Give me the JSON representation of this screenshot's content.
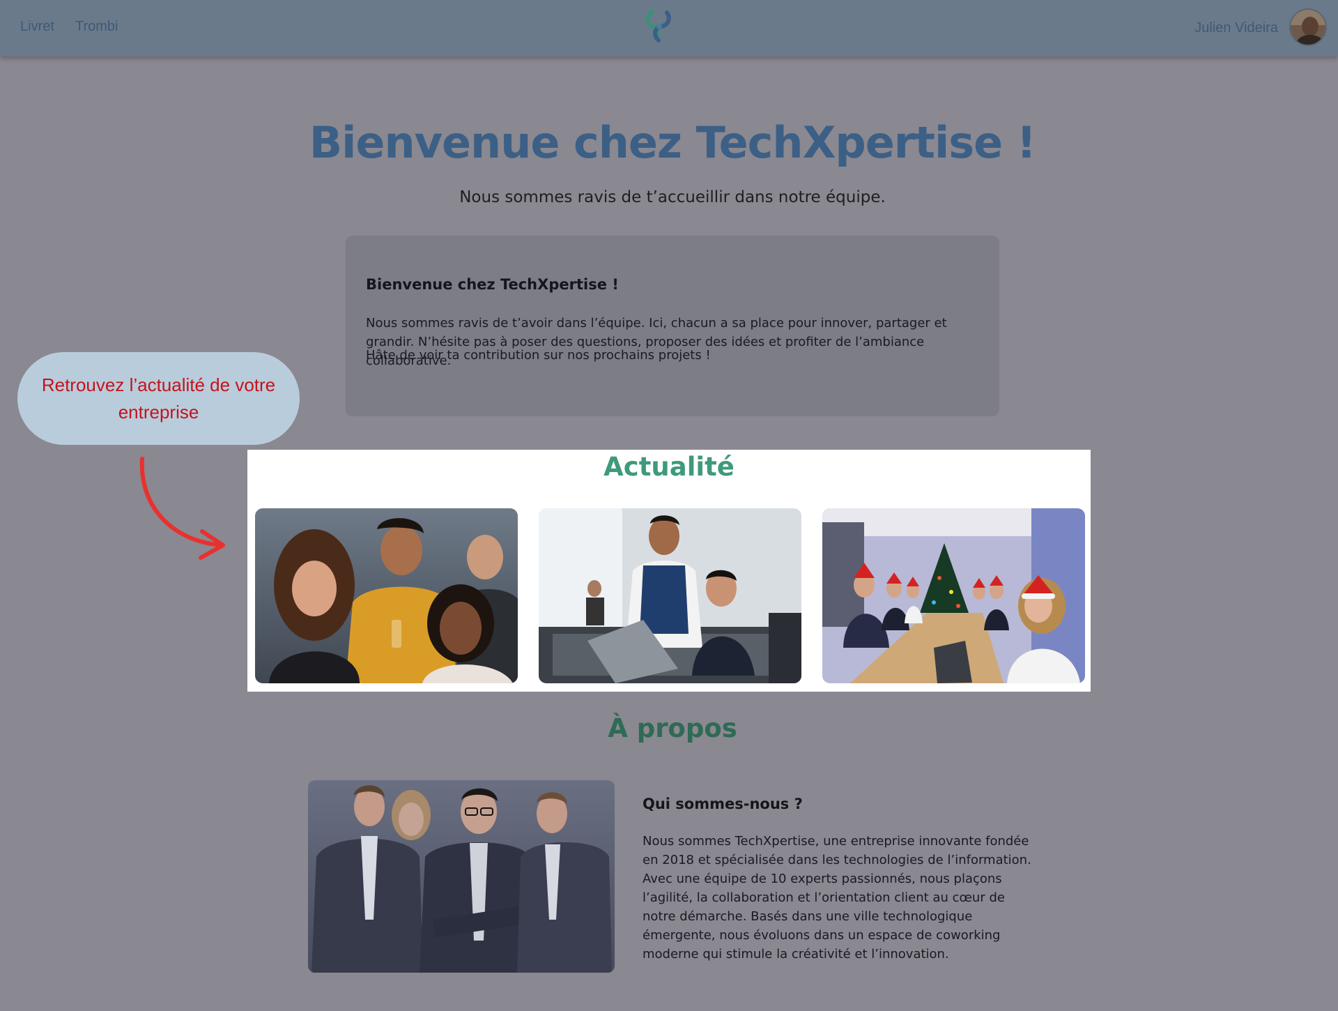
{
  "nav": {
    "links": [
      "Livret",
      "Trombi"
    ],
    "user_name": "Julien Videira"
  },
  "hero": {
    "title": "Bienvenue chez TechXpertise !",
    "subtitle": "Nous sommes ravis de t’accueillir dans notre équipe."
  },
  "welcome_card": {
    "heading": "Bienvenue chez TechXpertise !",
    "paragraph1": "Nous sommes ravis de t’avoir dans l’équipe. Ici, chacun a sa place pour innover, partager et grandir. N’hésite pas à poser des questions, proposer des idées et profiter de l’ambiance collaborative.",
    "paragraph2": "Hâte de voir ta contribution sur nos prochains projets !"
  },
  "callout": {
    "text": "Retrouvez l’actualité de votre entreprise"
  },
  "news": {
    "title": "Actualité"
  },
  "about": {
    "title": "À propos",
    "heading": "Qui sommes-nous ?",
    "text": "Nous sommes TechXpertise, une entreprise innovante fondée en 2018 et spécialisée dans les technologies de l’information. Avec une équipe de 10 experts passionnés, nous plaçons l’agilité, la collaboration et l’orientation client au cœur de notre démarche. Basés dans une ville technologique émergente, nous évoluons dans un espace de coworking moderne qui stimule la créativité et l’innovation."
  },
  "colors": {
    "page_bg": "#8a8890",
    "topbar_bg": "#6b7a8a",
    "hero_title": "#3c5f86",
    "news_title": "#3f9a7c",
    "about_title": "#2f6a55",
    "callout_bg": "#b9ccdc",
    "callout_text": "#c4131b",
    "arrow": "#e8312e"
  }
}
